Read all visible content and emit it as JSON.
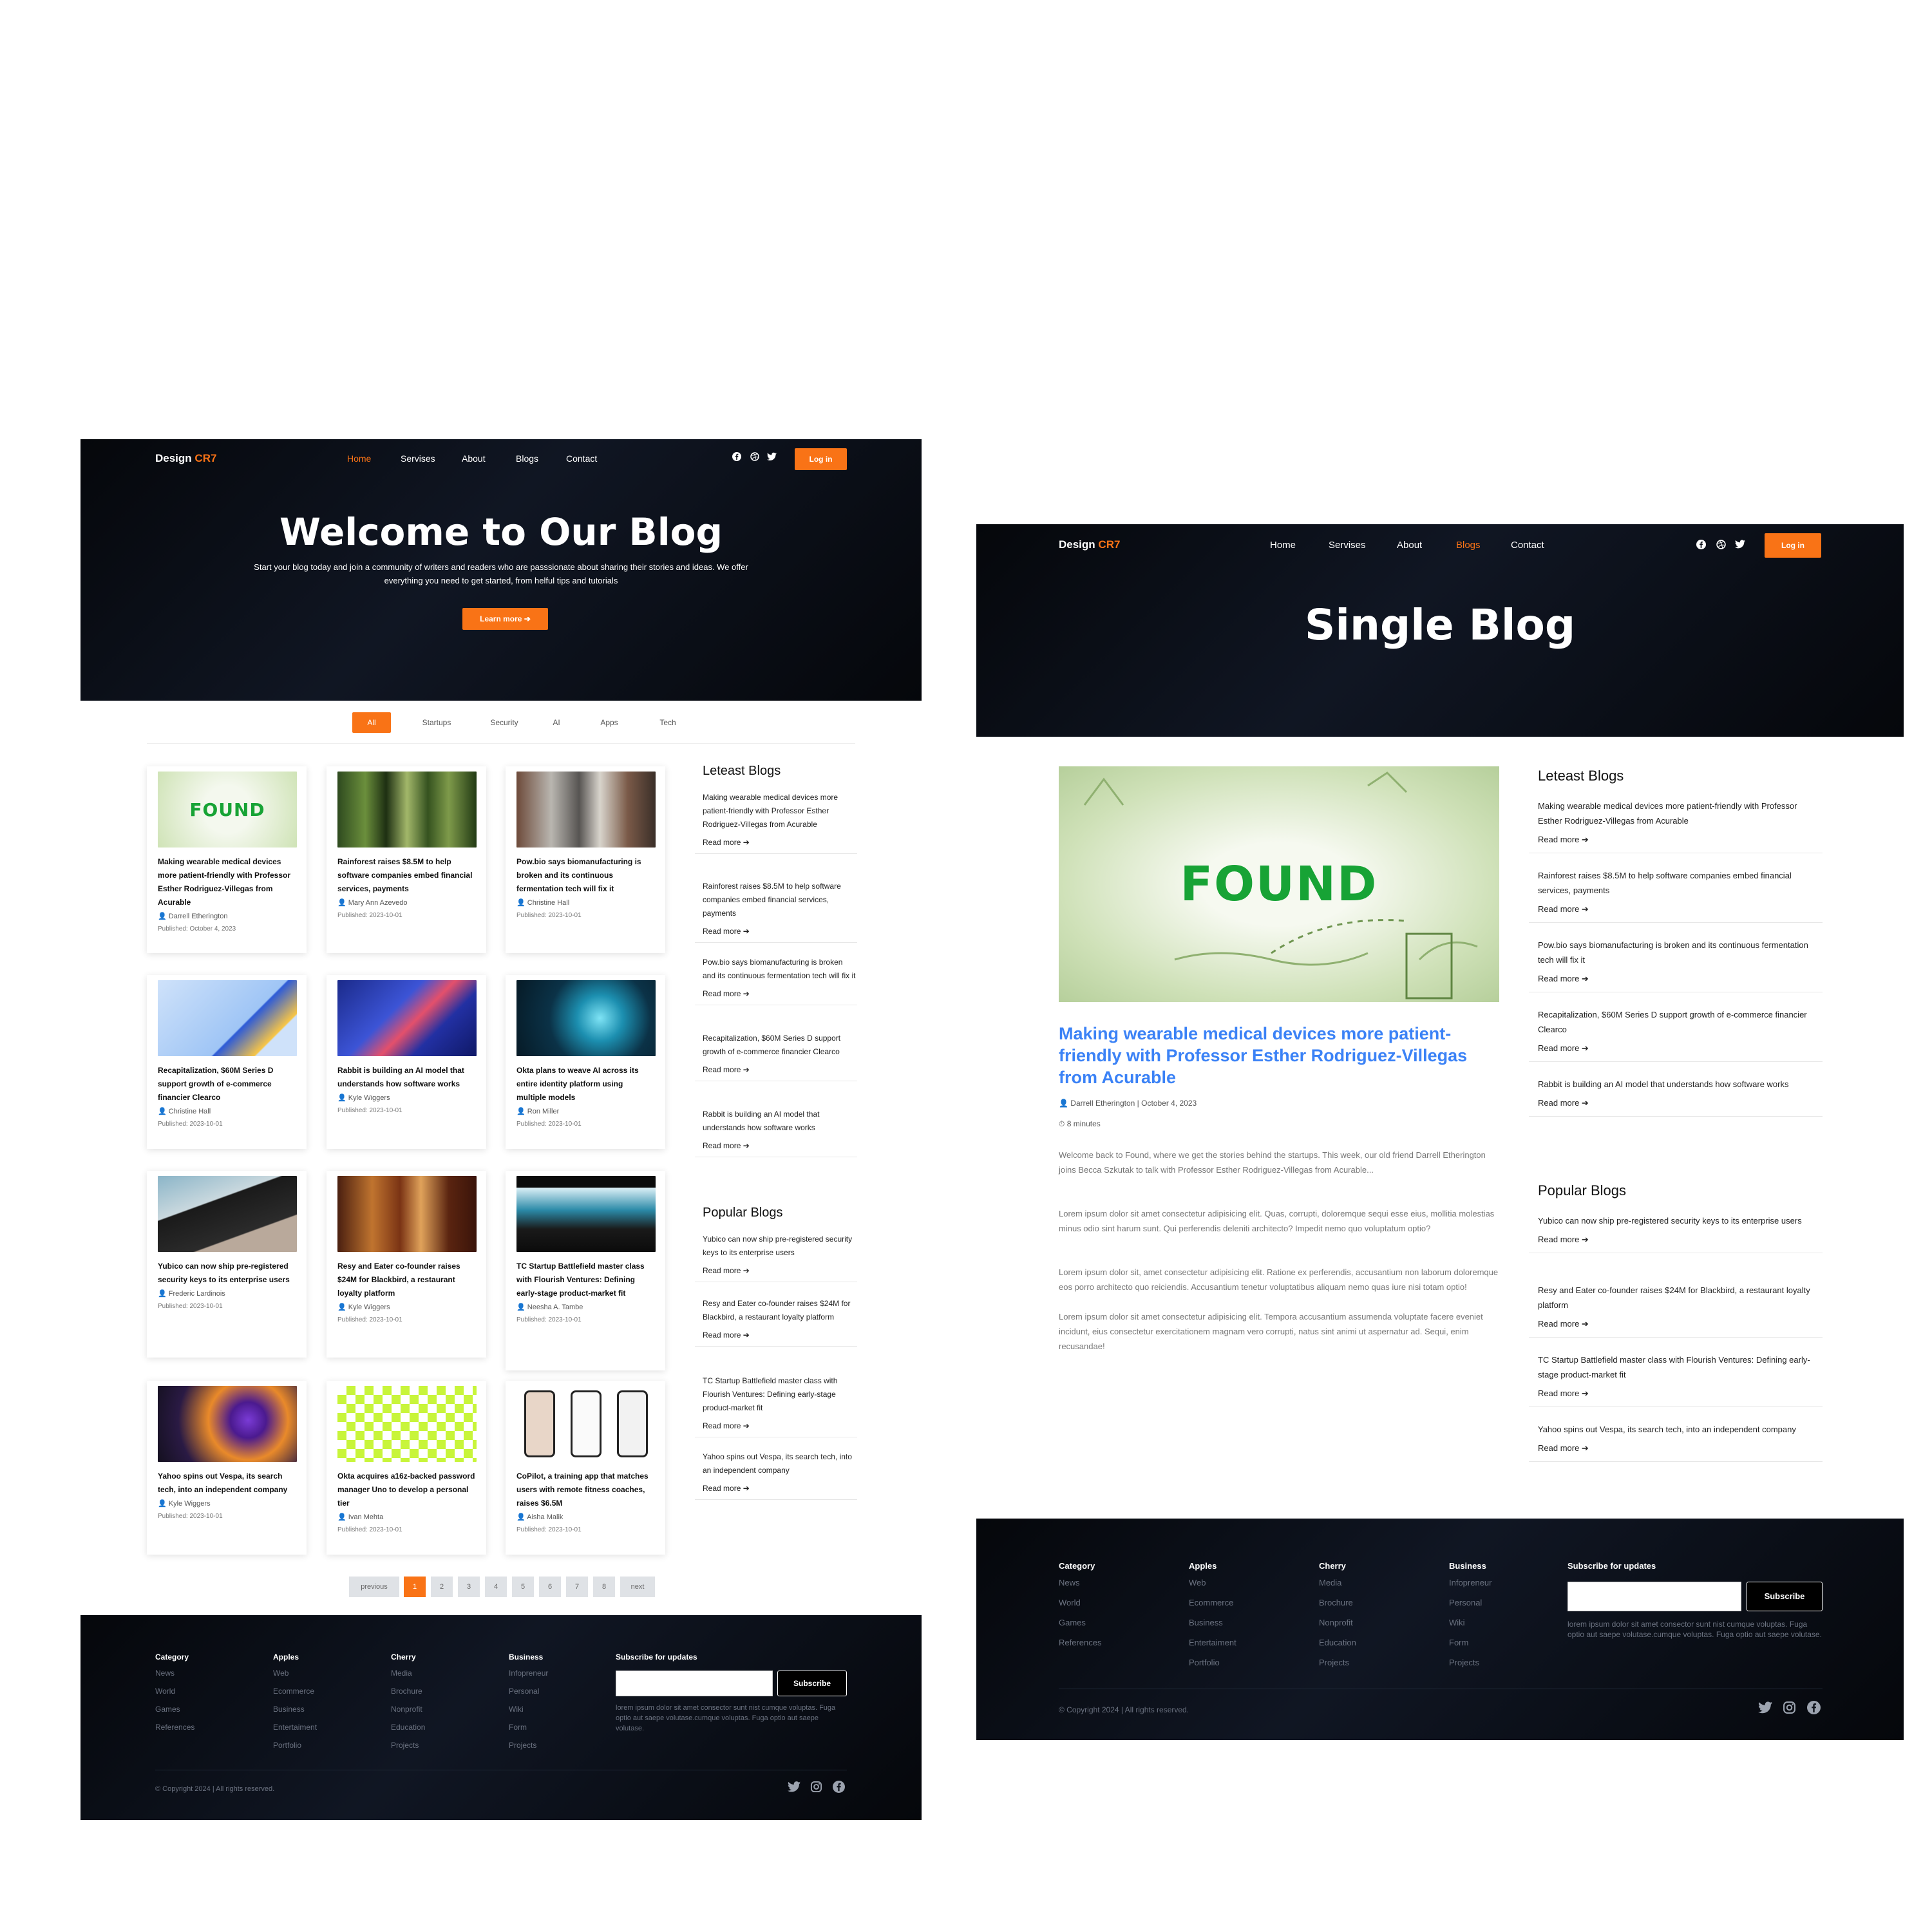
{
  "left": {
    "brand": {
      "name": "Design",
      "accent": "CR7"
    },
    "nav": [
      "Home",
      "Servises",
      "About",
      "Blogs",
      "Contact"
    ],
    "login": "Log in",
    "hero": {
      "title": "Welcome to Our Blog",
      "subtitle": "Start your blog today and join a community of writers and readers who are passsionate about sharing their stories and ideas. We offer everything you need to get started, from helful tips and tutorials",
      "cta": "Learn more ➔"
    },
    "filters": [
      "All",
      "Startups",
      "Security",
      "AI",
      "Apps",
      "Tech"
    ],
    "cards": [
      {
        "title": "Making wearable medical devices more patient-friendly with Professor Esther Rodriguez-Villegas from Acurable",
        "author": "Darrell Etherington",
        "date": "Published: October 4, 2023",
        "image": "found-illustration"
      },
      {
        "title": "Rainforest raises $8.5M to help software companies embed financial services, payments",
        "author": "Mary Ann Azevedo",
        "date": "Published: 2023-10-01",
        "image": "rainforest-photo"
      },
      {
        "title": "Pow.bio says biomanufacturing is broken and its continuous fermentation tech will fix it",
        "author": "Christine Hall",
        "date": "Published: 2023-10-01",
        "image": "lab-photo"
      },
      {
        "title": "Recapitalization, $60M Series D support growth of e-commerce financier Clearco",
        "author": "Christine Hall",
        "date": "Published: 2023-10-01",
        "image": "isometric-illustration"
      },
      {
        "title": "Rabbit is building an AI model that understands how software works",
        "author": "Kyle Wiggers",
        "date": "Published: 2023-10-01",
        "image": "circuit-illustration"
      },
      {
        "title": "Okta plans to weave AI across its entire identity platform using multiple models",
        "author": "Ron Miller",
        "date": "Published: 2023-10-01",
        "image": "ai-hand-photo"
      },
      {
        "title": "Yubico can now ship pre-registered security keys to its enterprise users",
        "author": "Frederic Lardinois",
        "date": "Published: 2023-10-01",
        "image": "yubikey-photo"
      },
      {
        "title": "Resy and Eater co-founder raises $24M for Blackbird, a restaurant loyalty platform",
        "author": "Kyle Wiggers",
        "date": "Published: 2023-10-01",
        "image": "restaurant-photo"
      },
      {
        "title": "TC Startup Battlefield master class with Flourish Ventures: Defining early-stage product-market fit",
        "author": "Neesha A. Tambe",
        "date": "Published: 2023-10-01",
        "image": "stage-photo"
      },
      {
        "title": "Yahoo spins out Vespa, its search tech, into an independent company",
        "author": "Kyle Wiggers",
        "date": "Published: 2023-10-01",
        "image": "yahoo-photo"
      },
      {
        "title": "Okta acquires a16z-backed password manager Uno to develop a personal tier",
        "author": "Ivan Mehta",
        "date": "Published: 2023-10-01",
        "image": "uno-app-screens"
      },
      {
        "title": "CoPilot, a training app that matches users with remote fitness coaches, raises $6.5M",
        "author": "Aisha Malik",
        "date": "Published: 2023-10-01",
        "image": "copilot-app-screens"
      }
    ],
    "latest_title": "Leteast Blogs",
    "latest": [
      "Making wearable medical devices more patient-friendly with Professor Esther Rodriguez-Villegas from Acurable",
      "Rainforest raises $8.5M to help software companies embed financial services, payments",
      "Pow.bio says biomanufacturing is broken and its continuous fermentation tech will fix it",
      "Recapitalization, $60M Series D support growth of e-commerce financier Clearco",
      "Rabbit is building an AI model that understands how software works"
    ],
    "popular_title": "Popular Blogs",
    "popular": [
      "Yubico can now ship pre-registered security keys to its enterprise users",
      "Resy and Eater co-founder raises $24M for Blackbird, a restaurant loyalty platform",
      "TC Startup Battlefield master class with Flourish Ventures: Defining early-stage product-market fit",
      "Yahoo spins out Vespa, its search tech, into an independent company"
    ],
    "read_more": "Read more ➔",
    "pagination": [
      "previous",
      "1",
      "2",
      "3",
      "4",
      "5",
      "6",
      "7",
      "8",
      "next"
    ],
    "current_page": "1"
  },
  "right": {
    "nav": [
      "Home",
      "Servises",
      "About",
      "Blogs",
      "Contact"
    ],
    "login": "Log in",
    "hero_title": "Single Blog",
    "post": {
      "image_text": "FOUND",
      "title": "Making wearable medical devices more patient-friendly with Professor Esther Rodriguez-Villegas from Acurable",
      "byline": "Darrell Etherington | October 4, 2023",
      "read_time": "8 minutes",
      "p1": "Welcome back to Found, where we get the stories behind the startups. This week, our old friend Darrell Etherington joins Becca Szkutak to talk with Professor Esther Rodriguez-Villegas from Acurable...",
      "p2": "Lorem ipsum dolor sit amet consectetur adipisicing elit. Quas, corrupti, doloremque sequi esse eius, mollitia molestias minus odio sint harum sunt. Qui perferendis deleniti architecto? Impedit nemo quo voluptatum optio?",
      "p3": "Lorem ipsum dolor sit, amet consectetur adipisicing elit. Ratione ex perferendis, accusantium non laborum doloremque eos porro architecto quo reiciendis. Accusantium tenetur voluptatibus aliquam nemo quas iure nisi totam optio!",
      "p4": "Lorem ipsum dolor sit amet consectetur adipisicing elit. Tempora accusantium assumenda voluptate facere eveniet incidunt, eius consectetur exercitationem magnam vero corrupti, natus sint animi ut aspernatur ad. Sequi, enim recusandae!"
    }
  },
  "footer": {
    "columns": [
      {
        "title": "Category",
        "links": [
          "News",
          "World",
          "Games",
          "References"
        ]
      },
      {
        "title": "Apples",
        "links": [
          "Web",
          "Ecommerce",
          "Business",
          "Entertaiment",
          "Portfolio"
        ]
      },
      {
        "title": "Cherry",
        "links": [
          "Media",
          "Brochure",
          "Nonprofit",
          "Education",
          "Projects"
        ]
      },
      {
        "title": "Business",
        "links": [
          "Infopreneur",
          "Personal",
          "Wiki",
          "Form",
          "Projects"
        ]
      }
    ],
    "subscribe_title": "Subscribe for updates",
    "subscribe_button": "Subscribe",
    "subscribe_note": "lorem ipsum dolor sit amet consector sunt nist cumque voluptas. Fuga optio aut saepe volutase.cumque voluptas. Fuga optio aut saepe volutase.",
    "copyright": "© Copyright 2024 | All rights reserved."
  },
  "colors": {
    "accent": "#f97316",
    "dark": "#0b0f17",
    "link_blue": "#3b82f6"
  },
  "icons": [
    "facebook-icon",
    "dribbble-icon",
    "twitter-icon",
    "instagram-icon",
    "user-icon",
    "clock-icon",
    "arrow-right-icon"
  ]
}
